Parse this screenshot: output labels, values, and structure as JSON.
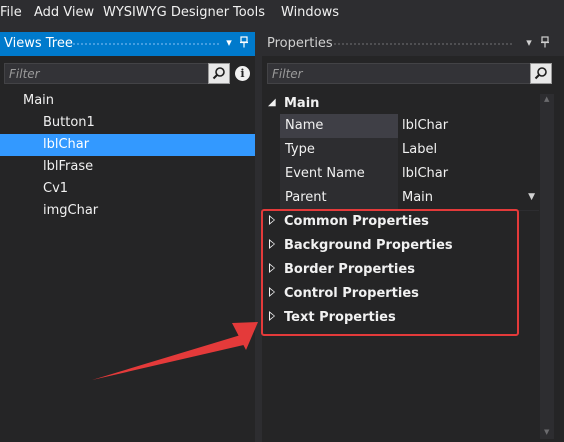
{
  "menu": {
    "file": "File",
    "add_view": "Add View",
    "wysiwyg": "WYSIWYG Designer",
    "tools": "Tools",
    "windows": "Windows"
  },
  "views_tree": {
    "title": "Views Tree",
    "filter_placeholder": "Filter",
    "info_glyph": "i",
    "items": [
      {
        "label": "Main",
        "selected": false
      },
      {
        "label": "Button1",
        "selected": false
      },
      {
        "label": "lblChar",
        "selected": true
      },
      {
        "label": "lblFrase",
        "selected": false
      },
      {
        "label": "Cv1",
        "selected": false
      },
      {
        "label": "imgChar",
        "selected": false
      }
    ]
  },
  "properties": {
    "title": "Properties",
    "filter_placeholder": "Filter",
    "group_label": "Main",
    "rows": [
      {
        "name": "Name",
        "value": "lblChar"
      },
      {
        "name": "Type",
        "value": "Label"
      },
      {
        "name": "Event Name",
        "value": "lblChar"
      },
      {
        "name": "Parent",
        "value": "Main"
      }
    ],
    "categories": [
      "Common Properties",
      "Background Properties",
      "Border Properties",
      "Control Properties",
      "Text Properties"
    ]
  },
  "colors": {
    "accent": "#007acc",
    "selection": "#3399ff",
    "annotation": "#e43a3a"
  },
  "icons": {
    "pane_menu": "chevron-down-icon",
    "pane_pin": "pin-icon",
    "search": "search-icon",
    "info": "info-icon"
  }
}
